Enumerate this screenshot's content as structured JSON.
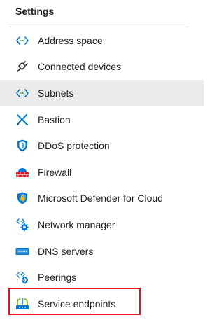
{
  "settings": {
    "header": "Settings",
    "items": [
      {
        "label": "Address space",
        "icon": "address-space-icon"
      },
      {
        "label": "Connected devices",
        "icon": "connected-devices-icon"
      },
      {
        "label": "Subnets",
        "icon": "subnets-icon"
      },
      {
        "label": "Bastion",
        "icon": "bastion-icon"
      },
      {
        "label": "DDoS protection",
        "icon": "ddos-protection-icon"
      },
      {
        "label": "Firewall",
        "icon": "firewall-icon"
      },
      {
        "label": "Microsoft Defender for Cloud",
        "icon": "defender-icon"
      },
      {
        "label": "Network manager",
        "icon": "network-manager-icon"
      },
      {
        "label": "DNS servers",
        "icon": "dns-servers-icon"
      },
      {
        "label": "Peerings",
        "icon": "peerings-icon"
      },
      {
        "label": "Service endpoints",
        "icon": "service-endpoints-icon"
      }
    ],
    "selected_index": 2,
    "highlighted_index": 10
  },
  "colors": {
    "selected_background": "#edebe9",
    "highlight_border": "#e81123",
    "azure_blue": "#0078d4",
    "text": "#242424"
  }
}
